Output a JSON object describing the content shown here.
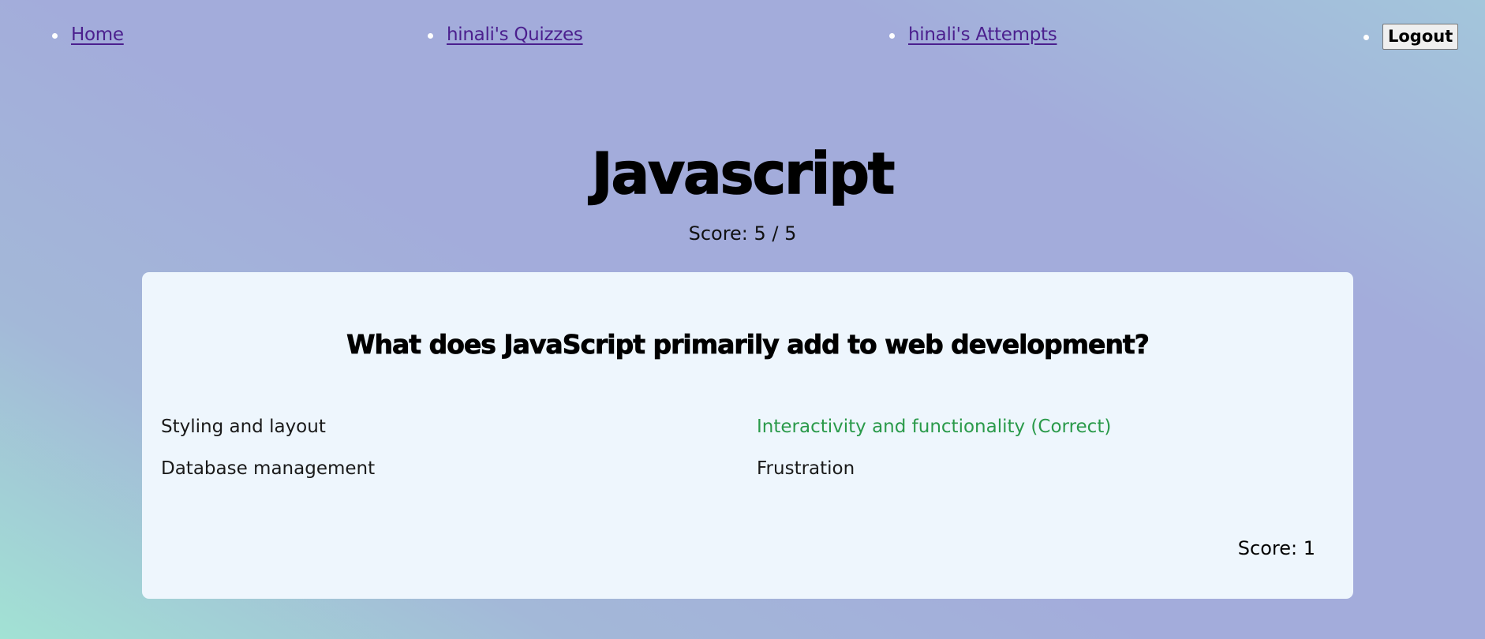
{
  "nav": {
    "home": "Home",
    "quizzes": "hinali's Quizzes",
    "attempts": "hinali's Attempts",
    "logout": "Logout"
  },
  "quiz": {
    "title": "Javascript",
    "score_text": "Score: 5 / 5"
  },
  "question": {
    "text": "What does JavaScript primarily add to web development?",
    "options": [
      {
        "label": "Styling and layout",
        "correct": false
      },
      {
        "label": "Interactivity and functionality (Correct)",
        "correct": true
      },
      {
        "label": "Database management",
        "correct": false
      },
      {
        "label": "Frustration",
        "correct": false
      }
    ],
    "score_text": "Score: 1"
  },
  "colors": {
    "link": "#4b1f8e",
    "correct": "#2a9a4a",
    "card_bg": "#eef6fd"
  }
}
